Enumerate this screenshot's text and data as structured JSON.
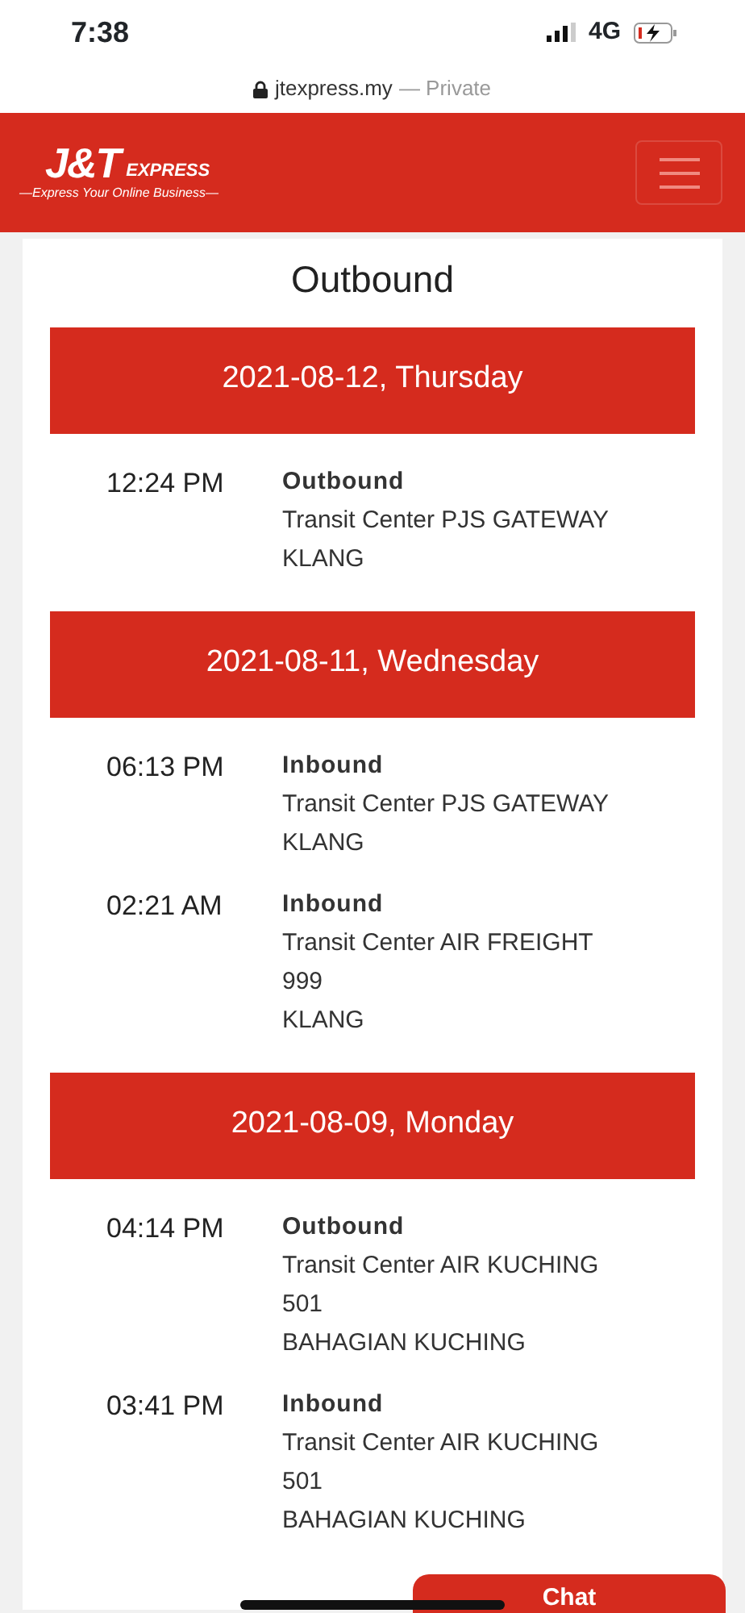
{
  "status_bar": {
    "time": "7:38",
    "network": "4G"
  },
  "browser": {
    "url": "jtexpress.my",
    "mode": "— Private"
  },
  "header": {
    "logo_main": "J&T",
    "logo_sub": "EXPRESS",
    "tagline": "—Express Your Online Business—"
  },
  "title": "Outbound",
  "days": [
    {
      "date": "2021-08-12, Thursday",
      "events": [
        {
          "time": "12:24 PM",
          "status": "Outbound",
          "place": "Transit Center PJS GATEWAY",
          "city": "KLANG"
        }
      ]
    },
    {
      "date": "2021-08-11, Wednesday",
      "events": [
        {
          "time": "06:13 PM",
          "status": "Inbound",
          "place": "Transit Center PJS GATEWAY",
          "city": "KLANG"
        },
        {
          "time": "02:21 AM",
          "status": "Inbound",
          "place": "Transit Center AIR FREIGHT 999",
          "city": "KLANG"
        }
      ]
    },
    {
      "date": "2021-08-09, Monday",
      "events": [
        {
          "time": "04:14 PM",
          "status": "Outbound",
          "place": "Transit Center AIR KUCHING 501",
          "city": "BAHAGIAN KUCHING"
        },
        {
          "time": "03:41 PM",
          "status": "Inbound",
          "place": "Transit Center AIR KUCHING 501",
          "city": "BAHAGIAN KUCHING"
        }
      ]
    }
  ],
  "chat_button": "Chat"
}
